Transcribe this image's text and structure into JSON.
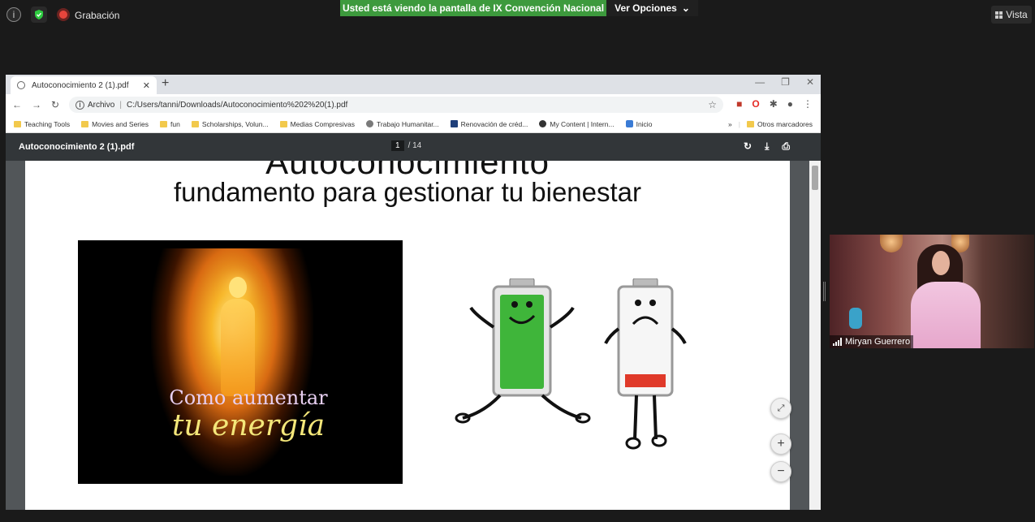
{
  "zoom": {
    "recording_label": "Grabación",
    "share_banner": "Usted está viendo la pantalla de IX Convención Nacional",
    "view_options": "Ver Opciones",
    "view_label": "Vista",
    "participant_name": "Miryan Guerrero"
  },
  "browser": {
    "tab_title": "Autoconocimiento 2 (1).pdf",
    "address_prefix": "Archivo",
    "address": "C:/Users/tanni/Downloads/Autoconocimiento%202%20(1).pdf",
    "bookmarks": [
      {
        "label": "Teaching Tools",
        "icon": "folder"
      },
      {
        "label": "Movies and Series",
        "icon": "folder"
      },
      {
        "label": "fun",
        "icon": "folder"
      },
      {
        "label": "Scholarships, Volun...",
        "icon": "folder"
      },
      {
        "label": "Medias Compresivas",
        "icon": "folder"
      },
      {
        "label": "Trabajo Humanitar...",
        "icon": "globe"
      },
      {
        "label": "Renovación de créd...",
        "icon": "site"
      },
      {
        "label": "My Content | Intern...",
        "icon": "site"
      },
      {
        "label": "Inicio",
        "icon": "site"
      }
    ],
    "overflow": "»",
    "other_bookmarks": "Otros marcadores"
  },
  "pdf": {
    "filename": "Autoconocimiento 2 (1).pdf",
    "current_page": "1",
    "total_pages": "/ 14",
    "slide": {
      "title": "Autoconocimiento",
      "subtitle": "fundamento para gestionar tu bienestar",
      "image_text_1": "Como aumentar",
      "image_text_2": "tu energía"
    }
  },
  "colors": {
    "share_green": "#3d9a3d",
    "pdf_toolbar": "#323639",
    "battery_full": "#3fb53a",
    "battery_low": "#e03a2a"
  }
}
